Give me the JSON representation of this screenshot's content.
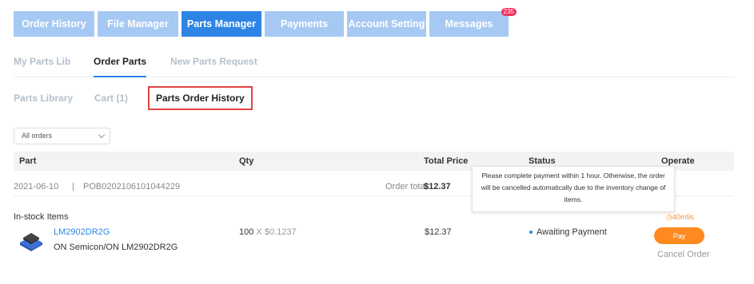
{
  "top_tabs": [
    {
      "label": "Order History"
    },
    {
      "label": "File Manager"
    },
    {
      "label": "Parts Manager"
    },
    {
      "label": "Payments"
    },
    {
      "label": "Account Setting"
    },
    {
      "label": "Messages",
      "badge": "235"
    }
  ],
  "sub_tabs": [
    {
      "label": "My Parts Lib"
    },
    {
      "label": "Order Parts"
    },
    {
      "label": "New Parts Request"
    }
  ],
  "third_tabs": [
    {
      "label": "Parts Library"
    },
    {
      "label": "Cart (1)"
    },
    {
      "label": "Parts Order History"
    }
  ],
  "filter": {
    "selected": "All orders"
  },
  "table": {
    "headers": [
      "Part",
      "Qty",
      "Total Price",
      "Status",
      "Operate"
    ]
  },
  "order": {
    "date": "2021-06-10",
    "separator": "|",
    "number": "POB0202106101044229",
    "total_label": "Order total:",
    "total_value": "$12.37"
  },
  "section_label": "In-stock Items",
  "item": {
    "part_number": "LM2902DR2G",
    "description": "ON Semicon/ON LM2902DR2G",
    "qty": "100",
    "qty_x": "X",
    "unit_price": "$0.1237",
    "price": "$12.37",
    "status": "Awaiting Payment",
    "timer": "40m9s",
    "pay_label": "Pay",
    "cancel_label": "Cancel Order"
  },
  "tooltip": {
    "text": "Please complete payment within 1 hour. Otherwise, the order will be cancelled automatically due to the inventory change of items."
  },
  "colors": {
    "primary": "#2e84e4",
    "tab_inactive": "#a6c9f3",
    "accent_orange": "#ff8a1f",
    "highlight_border": "#e04343"
  }
}
